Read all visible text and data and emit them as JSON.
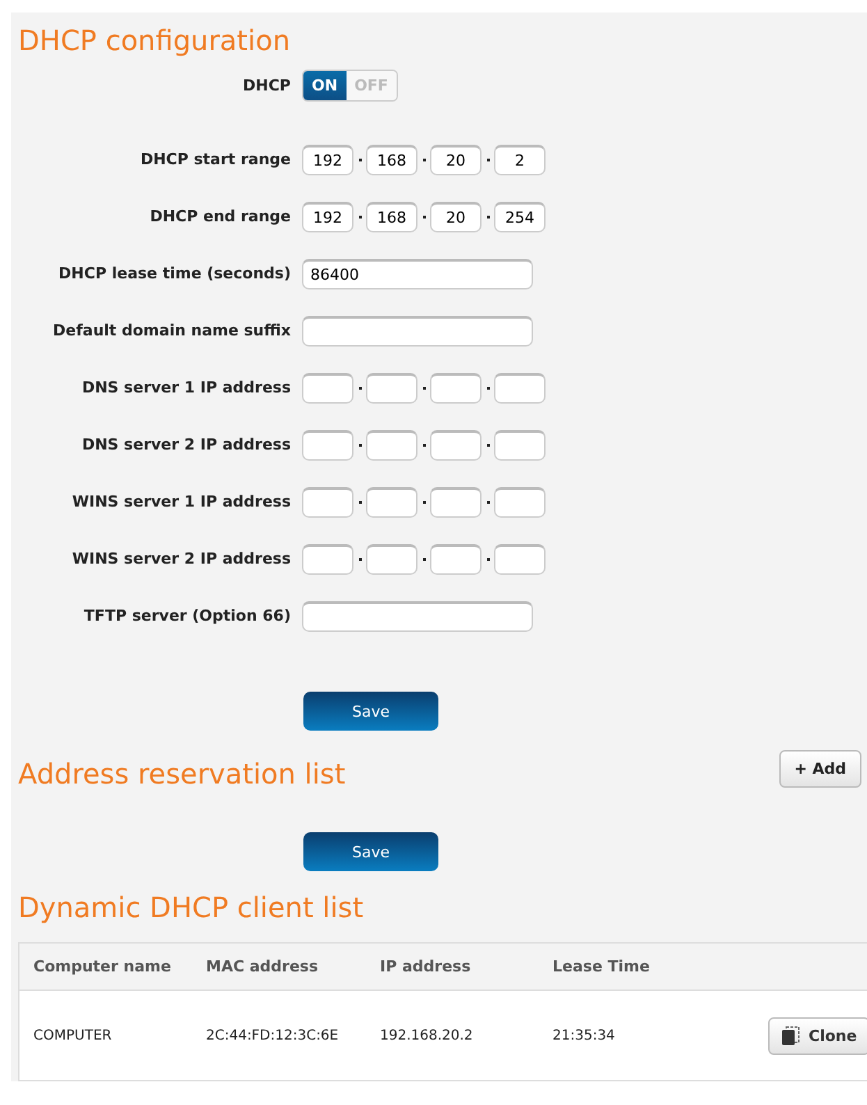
{
  "dhcp_section": {
    "title": "DHCP configuration",
    "toggle": {
      "label": "DHCP",
      "on_text": "ON",
      "off_text": "OFF",
      "on": true
    },
    "fields": [
      {
        "kind": "ip",
        "label": "DHCP start range",
        "octets": [
          "192",
          "168",
          "20",
          "2"
        ]
      },
      {
        "kind": "ip",
        "label": "DHCP end range",
        "octets": [
          "192",
          "168",
          "20",
          "254"
        ]
      },
      {
        "kind": "text",
        "label": "DHCP lease time (seconds)",
        "value": "86400"
      },
      {
        "kind": "text",
        "label": "Default domain name suffix"
      },
      {
        "kind": "ip",
        "label": "DNS server 1 IP address"
      },
      {
        "kind": "ip",
        "label": "DNS server 2 IP address"
      },
      {
        "kind": "ip",
        "label": "WINS server 1 IP address"
      },
      {
        "kind": "ip",
        "label": "WINS server 2 IP address"
      },
      {
        "kind": "text",
        "label": "TFTP server (Option 66)"
      }
    ],
    "save_button": "Save"
  },
  "reservation_section": {
    "title": "Address reservation list",
    "add_button": "+ Add",
    "save_button": "Save"
  },
  "client_section": {
    "title": "Dynamic DHCP client list",
    "columns": [
      "Computer name",
      "MAC address",
      "IP address",
      "Lease Time"
    ],
    "rows": [
      {
        "cells": [
          "COMPUTER",
          "2C:44:FD:12:3C:6E",
          "192.168.20.2",
          "21:35:34"
        ],
        "button": "Clone"
      }
    ]
  }
}
